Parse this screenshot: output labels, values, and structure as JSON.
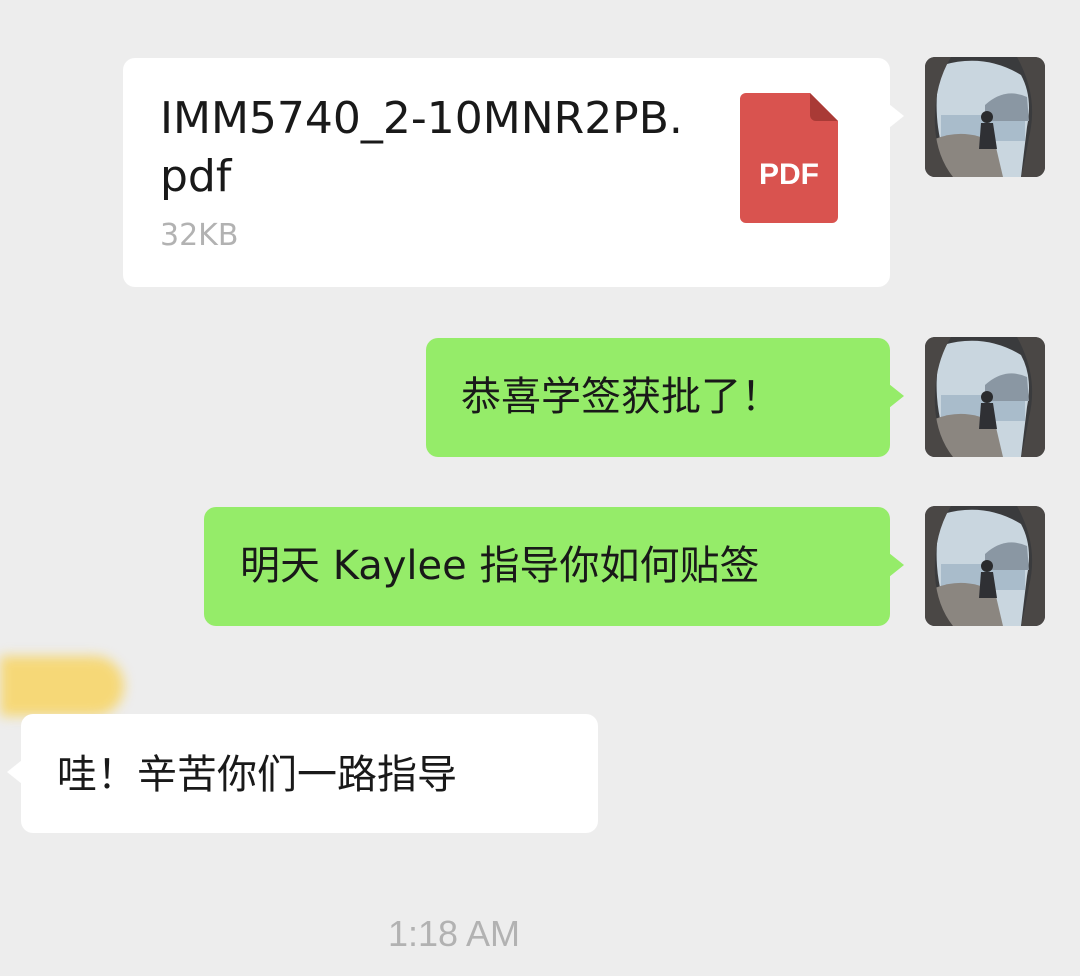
{
  "messages": {
    "file": {
      "name": "IMM5740_2-10MNR2PB.pdf",
      "size": "32KB",
      "type_label": "PDF",
      "type_color": "#d9534f"
    },
    "msg1": "恭喜学签获批了！",
    "msg2": "明天 Kaylee 指导你如何贴签",
    "msg3": "哇！辛苦你们一路指导"
  },
  "timestamp": "1:18 AM",
  "colors": {
    "background": "#ededed",
    "bubble_outgoing": "#95ec69",
    "bubble_incoming": "#ffffff",
    "secondary_text": "#b2b2b2"
  },
  "icons": {
    "file": "pdf-file-icon",
    "avatar": "user-avatar-photo"
  }
}
